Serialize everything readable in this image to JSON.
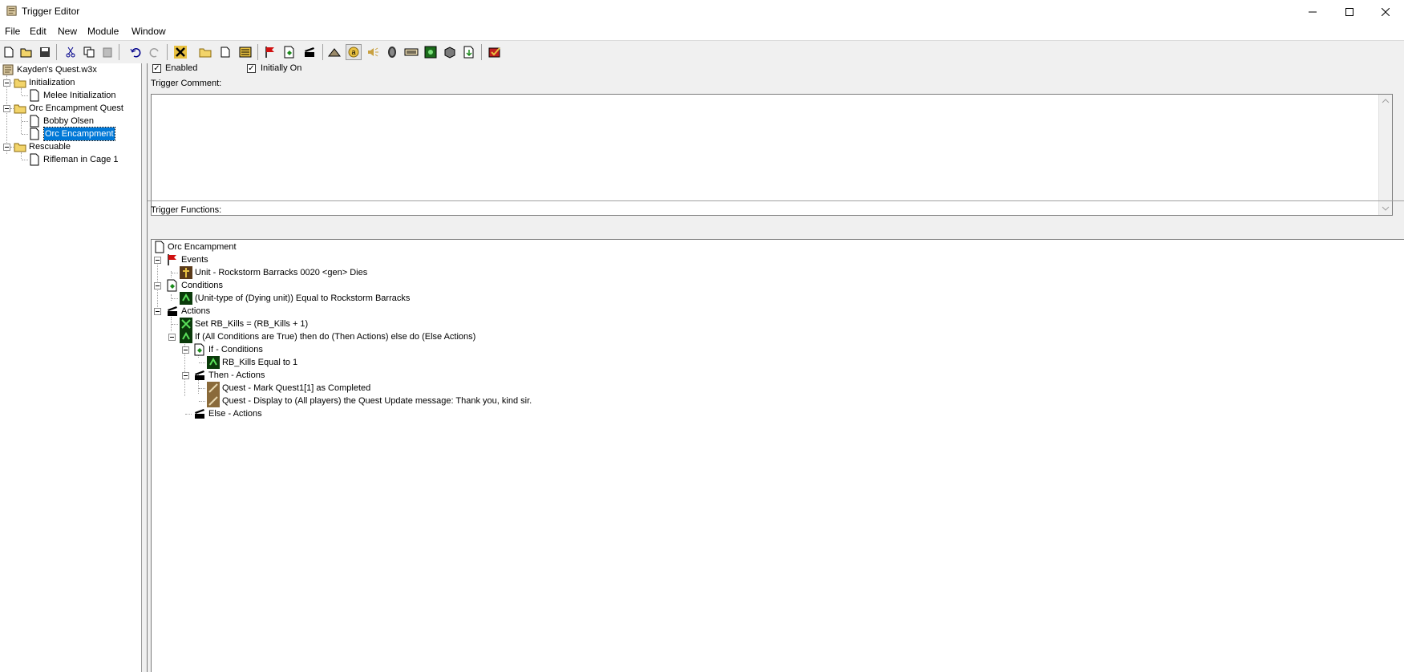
{
  "window": {
    "title": "Trigger Editor"
  },
  "menu": {
    "items": [
      "File",
      "Edit",
      "New",
      "Module",
      "Window"
    ]
  },
  "toolbar": {
    "icons": [
      "new-icon",
      "open-icon",
      "save-icon",
      "cut-icon",
      "copy-icon",
      "paste-icon",
      "undo-icon",
      "redo-icon",
      "variable-icon",
      "new-category-icon",
      "new-trigger-icon",
      "new-comment-icon",
      "event-icon",
      "condition-icon",
      "action-icon",
      "terrain-editor-icon",
      "trigger-editor-icon",
      "sound-editor-icon",
      "object-editor-icon",
      "campaign-editor-icon",
      "ai-editor-icon",
      "import-manager-icon",
      "object-manager-icon",
      "test-map-icon"
    ]
  },
  "tree": {
    "root": "Kayden's Quest.w3x",
    "items": [
      {
        "label": "Initialization",
        "type": "folder"
      },
      {
        "label": "Melee Initialization",
        "type": "trigger"
      },
      {
        "label": "Orc Encampment Quest",
        "type": "folder"
      },
      {
        "label": "Bobby Olsen",
        "type": "trigger"
      },
      {
        "label": "Orc Encampment",
        "type": "trigger",
        "selected": true
      },
      {
        "label": "Rescuable",
        "type": "folder"
      },
      {
        "label": "Rifleman in Cage 1",
        "type": "trigger"
      }
    ]
  },
  "trigger": {
    "enabled_label": "Enabled",
    "enabled": true,
    "initially_on_label": "Initially On",
    "initially_on": true,
    "comment_label": "Trigger Comment:",
    "comment": "",
    "functions_label": "Trigger Functions:"
  },
  "functions": [
    "Orc Encampment",
    "Events",
    "Unit - Rockstorm Barracks 0020 <gen> Dies",
    "Conditions",
    "(Unit-type of (Dying unit)) Equal to Rockstorm Barracks",
    "Actions",
    "Set RB_Kills = (RB_Kills + 1)",
    "If (All Conditions are True) then do (Then Actions) else do (Else Actions)",
    "If - Conditions",
    "RB_Kills Equal to 1",
    "Then - Actions",
    "Quest - Mark Quest1[1] as Completed",
    "Quest - Display to (All players) the Quest Update message: Thank you, kind sir.",
    "Else - Actions"
  ],
  "colors": {
    "selection": "#0078d7",
    "panel_bg": "#f0f0f0",
    "event_flag": "#d01010",
    "condition_green": "#1a8a1a"
  }
}
